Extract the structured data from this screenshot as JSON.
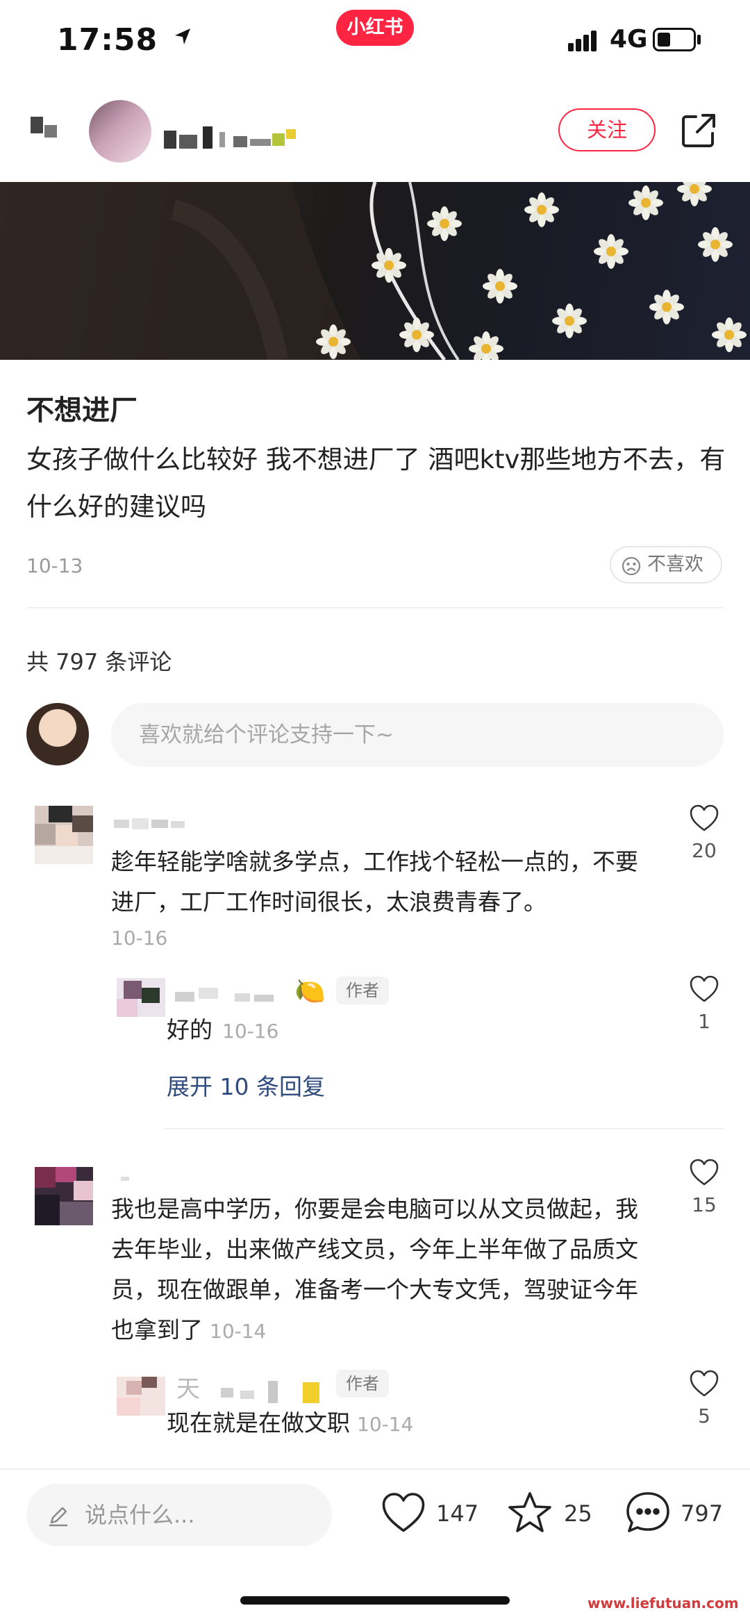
{
  "status_bar": {
    "time": "17:58",
    "brand": "小红书",
    "network": "4G"
  },
  "header": {
    "follow_label": "关注"
  },
  "post": {
    "title": "不想进厂",
    "body": "女孩子做什么比较好 我不想进厂了 酒吧ktv那些地方不去，有什么好的建议吗",
    "date": "10-13",
    "dislike_label": "不喜欢"
  },
  "comments_section": {
    "count_label": "共 797 条评论",
    "input_placeholder": "喜欢就给个评论支持一下~"
  },
  "comments": [
    {
      "text": "趁年轻能学啥就多学点，工作找个轻松一点的，不要进厂，工厂工作时间很长，太浪费青春了。",
      "date": "10-16",
      "likes": "20",
      "reply": {
        "author_name_visible": "🍋",
        "author_tag": "作者",
        "text": "好的",
        "date": "10-16",
        "likes": "1"
      },
      "expand_label": "展开 10 条回复"
    },
    {
      "text": "我也是高中学历，你要是会电脑可以从文员做起，我去年毕业，出来做产线文员，今年上半年做了品质文员，现在做跟单，准备考一个大专文凭，驾驶证今年也拿到了",
      "date": "10-14",
      "likes": "15",
      "reply": {
        "author_name_visible": "天",
        "author_tag": "作者",
        "text": "现在就是在做文职",
        "date": "10-14",
        "likes": "5"
      }
    }
  ],
  "bottom_bar": {
    "input_placeholder": "说点什么...",
    "like_count": "147",
    "collect_count": "25",
    "comment_count": "797"
  },
  "watermark": "www.liefutuan.com",
  "colors": {
    "brand_red": "#ff2442",
    "link_blue": "#2f4b7d"
  }
}
